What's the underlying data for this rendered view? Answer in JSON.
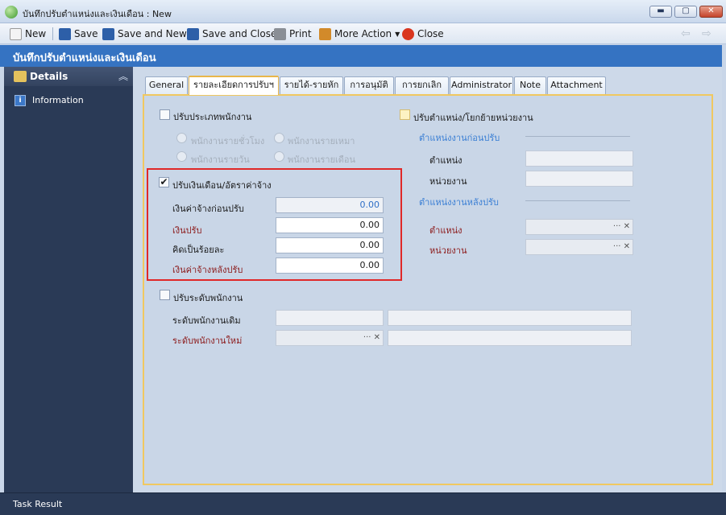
{
  "window": {
    "title": "บันทึกปรับตำแหน่งและเงินเดือน : New",
    "min": "▬",
    "max": "▢",
    "close": "✕"
  },
  "toolbar": {
    "new": "New",
    "save": "Save",
    "save_new": "Save and New",
    "save_close": "Save and Close",
    "print": "Print",
    "more_action": "More Action",
    "close": "Close",
    "back": "⇦",
    "forward": "⇨"
  },
  "header": {
    "title": "บันทึกปรับตำแหน่งและเงินเดือน"
  },
  "sidebar": {
    "section": "Details",
    "toggle": "︽",
    "items": [
      {
        "label": "Information",
        "icon": "i"
      }
    ]
  },
  "bottom": {
    "label": "Task Result"
  },
  "tabs": [
    "General",
    "รายละเอียดการปรับฯ",
    "รายได้-รายหัก",
    "การอนุมัติ",
    "การยกเลิก",
    "Administrator",
    "Note",
    "Attachment"
  ],
  "active_tab": "รายละเอียดการปรับฯ",
  "form": {
    "employee_type": {
      "label": "ปรับประเภทพนักงาน",
      "options": [
        "พนักงานรายชั่วโมง",
        "พนักงานรายเหมา",
        "พนักงานรายวัน",
        "พนักงานรายเดือน"
      ]
    },
    "salary": {
      "label": "ปรับเงินเดือน/อัตราค่าจ้าง",
      "checked": "✔",
      "before_label": "เงินค่าจ้างก่อนปรับ",
      "before_value": "0.00",
      "adjust_label": "เงินปรับ",
      "adjust_value": "0.00",
      "percent_label": "คิดเป็นร้อยละ",
      "percent_value": "0.00",
      "after_label": "เงินค่าจ้างหลังปรับ",
      "after_value": "0.00"
    },
    "level": {
      "label": "ปรับระดับพนักงาน",
      "old_label": "ระดับพนักงานเดิม",
      "new_label": "ระดับพนักงานใหม่",
      "lookup_text": "··· ✕"
    },
    "position": {
      "label": "ปรับตำแหน่ง/โยกย้ายหน่วยงาน",
      "before_section": "ตำแหน่งงานก่อนปรับ",
      "position_label": "ตำแหน่ง",
      "unit_label": "หน่วยงาน",
      "after_section": "ตำแหน่งงานหลังปรับ",
      "new_position_label": "ตำแหน่ง",
      "new_unit_label": "หน่วยงาน",
      "lookup_text": "··· ✕"
    }
  }
}
